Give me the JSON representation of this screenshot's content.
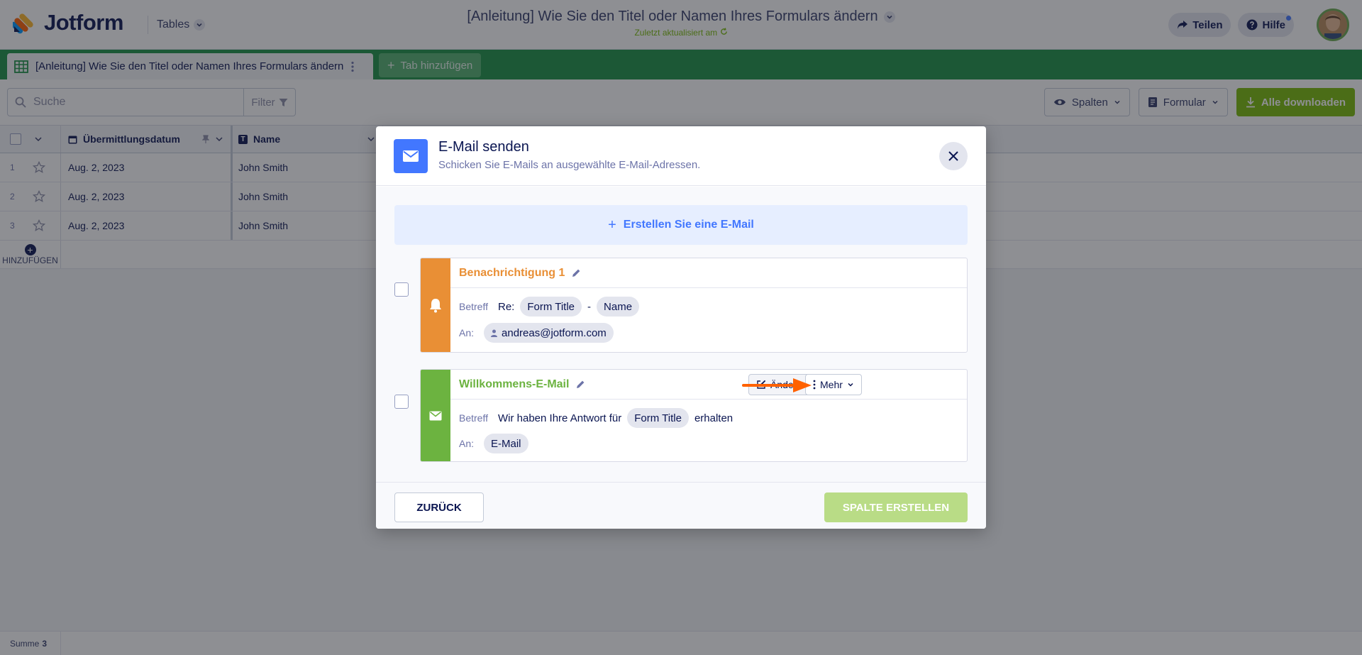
{
  "header": {
    "brand": "Jotform",
    "product": "Tables",
    "title": "[Anleitung] Wie Sie den Titel oder Namen Ihres Formulars ändern",
    "subtitle": "Zuletzt aktualisiert am",
    "share_label": "Teilen",
    "help_label": "Hilfe"
  },
  "tabs": {
    "active_label": "[Anleitung] Wie Sie den Titel oder Namen Ihres Formulars ändern",
    "add_label": "Tab hinzufügen"
  },
  "toolbar": {
    "search_placeholder": "Suche",
    "filter_label": "Filter",
    "columns_label": "Spalten",
    "form_label": "Formular",
    "download_label": "Alle downloaden"
  },
  "table": {
    "columns": [
      "Übermittlungsdatum",
      "Name"
    ],
    "rows": [
      {
        "num": "1",
        "date": "Aug. 2, 2023",
        "name": "John Smith"
      },
      {
        "num": "2",
        "date": "Aug. 2, 2023",
        "name": "John Smith"
      },
      {
        "num": "3",
        "date": "Aug. 2, 2023",
        "name": "John Smith"
      }
    ],
    "add_label": "HINZUFÜGEN"
  },
  "footer": {
    "sum_label": "Summe",
    "sum_value": "3"
  },
  "modal": {
    "title": "E-Mail senden",
    "subtitle": "Schicken Sie E-Mails an ausgewählte E-Mail-Adressen.",
    "create_label": "Erstellen Sie eine E-Mail",
    "emails": [
      {
        "name": "Benachrichtigung 1",
        "subject_key": "Betreff",
        "subject_prefix": "Re:",
        "subject_tag1": "Form Title",
        "subject_sep": "-",
        "subject_tag2": "Name",
        "to_key": "An:",
        "to_value": "andreas@jotform.com",
        "color": "#e98f35"
      },
      {
        "name": "Willkommens-E-Mail",
        "subject_key": "Betreff",
        "subject_prefix": "Wir haben Ihre Antwort für",
        "subject_tag1": "Form Title",
        "subject_suffix": "erhalten",
        "to_key": "An:",
        "to_value": "E-Mail",
        "edit_label": "Ändern",
        "more_label": "Mehr",
        "color": "#6cb340"
      }
    ],
    "back_label": "ZURÜCK",
    "submit_label": "SPALTE ERSTELLEN"
  },
  "colors": {
    "accent_blue": "#4277ff",
    "tab_green": "#1a9144",
    "download_green": "#78bb07",
    "arrow_orange": "#ff6100"
  }
}
